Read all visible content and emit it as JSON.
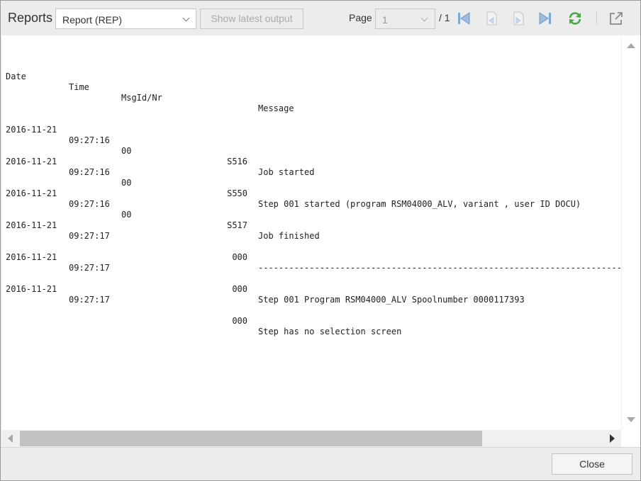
{
  "dialog": {
    "title": "Reports",
    "report_select": {
      "value": "Report (REP)"
    },
    "show_latest_label": "Show latest output",
    "page": {
      "label": "Page",
      "value": "1",
      "total": "/ 1"
    },
    "icons": [
      "first-page-icon",
      "previous-page-icon",
      "next-page-icon",
      "last-page-icon",
      "refresh-icon",
      "open-external-icon"
    ]
  },
  "log": {
    "headers": {
      "date": "Date",
      "time": "Time",
      "msgid": "MsgId/Nr",
      "message": "Message"
    },
    "rows": [
      {
        "date": "2016-11-21",
        "time": "09:27:16",
        "msgid": "00",
        "nr": "S516",
        "message": "Job started"
      },
      {
        "date": "2016-11-21",
        "time": "09:27:16",
        "msgid": "00",
        "nr": "S550",
        "message": "Step 001 started (program RSM04000_ALV, variant , user ID DOCU)"
      },
      {
        "date": "2016-11-21",
        "time": "09:27:16",
        "msgid": "00",
        "nr": "S517",
        "message": "Job finished"
      },
      {
        "date": "2016-11-21",
        "time": "09:27:17",
        "msgid": "",
        "nr": "000",
        "message": "--------------------------------------------------------------------------------------------------------------------------------"
      },
      {
        "date": "2016-11-21",
        "time": "09:27:17",
        "msgid": "",
        "nr": "000",
        "message": "Step 001 Program RSM04000_ALV Spoolnumber 0000117393"
      },
      {
        "date": "2016-11-21",
        "time": "09:27:17",
        "msgid": "",
        "nr": "000",
        "message": "Step has no selection screen"
      }
    ]
  },
  "footer": {
    "close_label": "Close"
  },
  "colors": {
    "toolbar_bg": "#ececec",
    "icon_blue": "#7da6d3",
    "refresh_green": "#4aa84a"
  }
}
